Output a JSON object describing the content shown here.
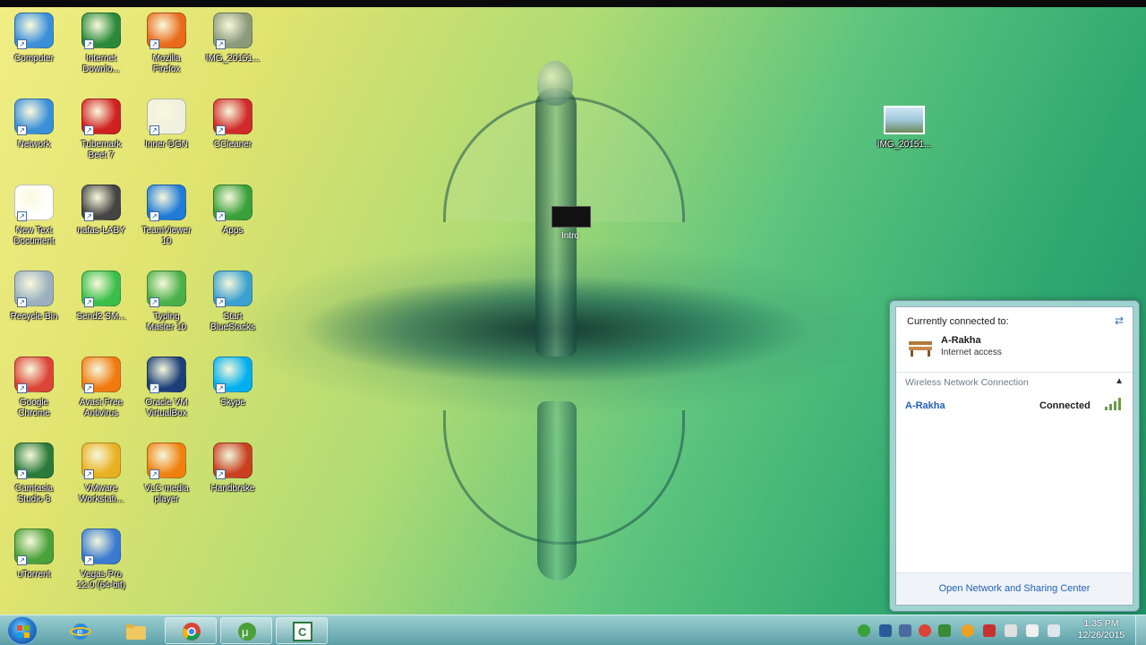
{
  "desktop_icons": [
    {
      "label": "Computer",
      "icon": "computer-icon",
      "color": "#3a8fd8"
    },
    {
      "label": "Internet\nDownlo...",
      "icon": "internet-download-manager-icon",
      "color": "#2a8a3a"
    },
    {
      "label": "Mozilla\nFirefox",
      "icon": "firefox-icon",
      "color": "#e86a1a"
    },
    {
      "label": "IMG_20151...",
      "icon": "photo-icon",
      "color": "#8a9a7a"
    },
    {
      "label": "Network",
      "icon": "network-icon",
      "color": "#3a8fd8"
    },
    {
      "label": "Tubemark\nBeet 7",
      "icon": "tubemark-icon",
      "color": "#d02020"
    },
    {
      "label": "Inner DGN",
      "icon": "document-app-icon",
      "color": "#f0f0e0"
    },
    {
      "label": "CCleaner",
      "icon": "ccleaner-icon",
      "color": "#d02a2a"
    },
    {
      "label": "New Text\nDocument",
      "icon": "text-document-icon",
      "color": "#ffffff"
    },
    {
      "label": "nafas-LABY",
      "icon": "usb-drive-icon",
      "color": "#444444"
    },
    {
      "label": "TeamViewer\n10",
      "icon": "teamviewer-icon",
      "color": "#1f7ad8"
    },
    {
      "label": "Apps",
      "icon": "apps-folder-icon",
      "color": "#3aa03a"
    },
    {
      "label": "Recycle Bin",
      "icon": "recycle-bin-icon",
      "color": "#9ab0c0"
    },
    {
      "label": "Send2 SM...",
      "icon": "sms-icon",
      "color": "#3abf4a"
    },
    {
      "label": "Typing\nMaster 10",
      "icon": "typing-master-icon",
      "color": "#4ab04a"
    },
    {
      "label": "Start\nBlueStacks",
      "icon": "bluestacks-icon",
      "color": "#3aa0d0"
    },
    {
      "label": "Google\nChrome",
      "icon": "chrome-icon",
      "color": "#db4437"
    },
    {
      "label": "Avast Free\nAntivirus",
      "icon": "avast-icon",
      "color": "#f07a10"
    },
    {
      "label": "Oracle VM\nVirtualBox",
      "icon": "virtualbox-icon",
      "color": "#1c3f7a"
    },
    {
      "label": "Skype",
      "icon": "skype-icon",
      "color": "#00aff0"
    },
    {
      "label": "Camtasia\nStudio 8",
      "icon": "camtasia-icon",
      "color": "#2a7a3a"
    },
    {
      "label": "VMware\nWorkstati...",
      "icon": "vmware-icon",
      "color": "#e8b020"
    },
    {
      "label": "VLC media\nplayer",
      "icon": "vlc-icon",
      "color": "#f08010"
    },
    {
      "label": "Handbrake",
      "icon": "handbrake-icon",
      "color": "#c84020"
    },
    {
      "label": "uTorrent",
      "icon": "utorrent-icon",
      "color": "#4aa03a"
    },
    {
      "label": "Vegas Pro\n12.0 (64-bit)",
      "icon": "vegas-pro-icon",
      "color": "#3a7ad0"
    }
  ],
  "desktop_extra": {
    "photo_label": "IMG_20151...",
    "intro_label": "Intro"
  },
  "network_flyout": {
    "currently_connected_label": "Currently connected to:",
    "network_name": "A-Rakha",
    "network_status": "Internet access",
    "section_title": "Wireless Network Connection",
    "wifi_name": "A-Rakha",
    "wifi_status": "Connected",
    "link_label": "Open Network and Sharing Center"
  },
  "taskbar": {
    "pinned": [
      {
        "icon": "internet-explorer-icon",
        "active": false
      },
      {
        "icon": "folder-icon",
        "active": false
      },
      {
        "icon": "chrome-icon",
        "active": true
      },
      {
        "icon": "utorrent-icon",
        "active": true
      },
      {
        "icon": "camtasia-icon",
        "active": true
      }
    ],
    "clock_time": "1:35 PM",
    "clock_date": "12/26/2015"
  },
  "colors": {
    "link_blue": "#1f5fbf",
    "taskbar_top": "#a0d2d7",
    "taskbar_bottom": "#5fa0aa"
  }
}
